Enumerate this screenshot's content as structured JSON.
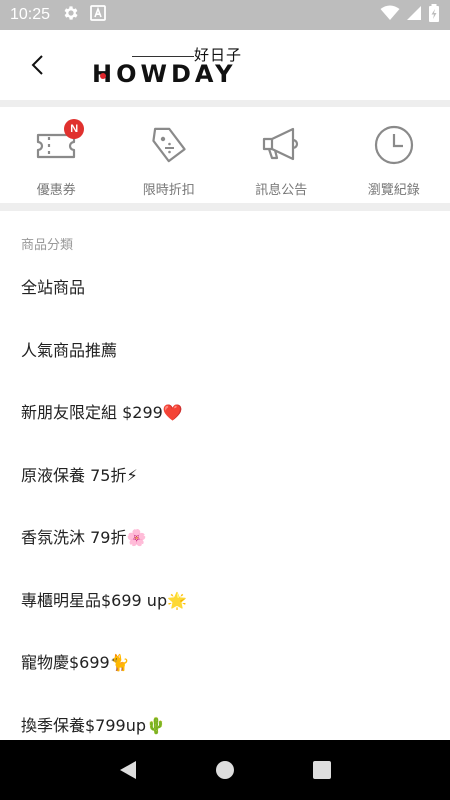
{
  "status_bar": {
    "time": "10:25"
  },
  "header": {
    "logo_main": "HOWDAY",
    "logo_sub": "好日子"
  },
  "shortcuts": [
    {
      "label": "優惠券",
      "icon": "ticket-icon",
      "badge": "N"
    },
    {
      "label": "限時折扣",
      "icon": "tag-icon"
    },
    {
      "label": "訊息公告",
      "icon": "megaphone-icon"
    },
    {
      "label": "瀏覽紀錄",
      "icon": "clock-icon"
    }
  ],
  "categories": {
    "header": "商品分類",
    "items": [
      "全站商品",
      "人氣商品推薦",
      "新朋友限定組 $299❤️",
      "原液保養 75折⚡",
      "香氛洗沐 79折🌸",
      "專櫃明星品$699 up🌟",
      "寵物慶$699🐈",
      "換季保養$799up🌵"
    ]
  },
  "colors": {
    "badge": "#e0312e",
    "status_bar": "#bdbdbd",
    "separator": "#eeeeee"
  }
}
